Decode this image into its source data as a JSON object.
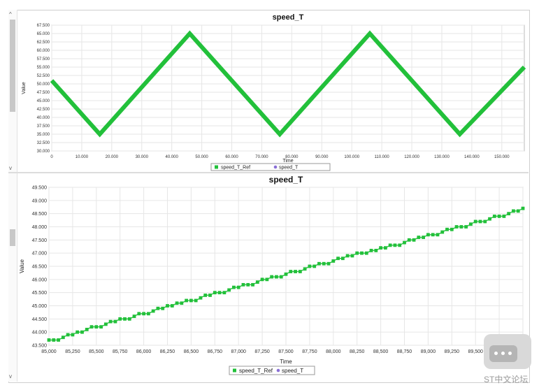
{
  "charts": [
    {
      "title": "speed_T",
      "xlabel": "Time",
      "ylabel": "Value",
      "yticks": [
        "30.000",
        "32.500",
        "35.000",
        "37.500",
        "40.000",
        "42.500",
        "45.000",
        "47.500",
        "50.000",
        "52.500",
        "55.000",
        "57.500",
        "60.000",
        "62.500",
        "65.000",
        "67.500"
      ],
      "xticks": [
        "0",
        "10.000",
        "20.000",
        "30.000",
        "40.000",
        "50.000",
        "60.000",
        "70.000",
        "80.000",
        "90.000",
        "100.000",
        "110.000",
        "120.000",
        "130.000",
        "140.000",
        "150.000"
      ],
      "legend": [
        "speed_T_Ref",
        "speed_T"
      ]
    },
    {
      "title": "speed_T",
      "xlabel": "Time",
      "ylabel": "Value",
      "yticks": [
        "43.500",
        "44.000",
        "44.500",
        "45.000",
        "45.500",
        "46.000",
        "46.500",
        "47.000",
        "47.500",
        "48.000",
        "48.500",
        "49.000",
        "49.500"
      ],
      "xticks": [
        "85,000",
        "85,250",
        "85,500",
        "85,750",
        "86,000",
        "86,250",
        "86,500",
        "86,750",
        "87,000",
        "87,250",
        "87,500",
        "87,750",
        "88,000",
        "88,250",
        "88,500",
        "88,750",
        "89,000",
        "89,250",
        "89,500",
        "89,750",
        "90,000"
      ],
      "legend": [
        "speed_T_Ref",
        "speed_T"
      ]
    }
  ],
  "colors": {
    "ref": "#22c03a",
    "speed": "#8a6fd6",
    "grid": "#e6e6e6"
  },
  "watermark": {
    "text": "ST中文论坛"
  },
  "chart_data": [
    {
      "type": "line",
      "title": "speed_T",
      "xlabel": "Time",
      "ylabel": "Value",
      "xlim": [
        0,
        157500
      ],
      "ylim": [
        30,
        67.5
      ],
      "grid": true,
      "legend_position": "bottom",
      "series": [
        {
          "name": "speed_T_Ref",
          "x": [
            0,
            16000,
            46000,
            76000,
            106000,
            136000,
            157500
          ],
          "y": [
            51,
            35,
            65,
            35,
            65,
            35,
            55
          ]
        }
      ]
    },
    {
      "type": "line",
      "title": "speed_T",
      "xlabel": "Time",
      "ylabel": "Value",
      "xlim": [
        85000,
        90000
      ],
      "ylim": [
        43.5,
        49.5
      ],
      "grid": true,
      "legend_position": "bottom",
      "series": [
        {
          "name": "speed_T_Ref",
          "x": [
            85000,
            85050,
            85100,
            85150,
            85200,
            85250,
            85300,
            85350,
            85400,
            85450,
            85500,
            85550,
            85600,
            85650,
            85700,
            85750,
            85800,
            85850,
            85900,
            85950,
            86000,
            86050,
            86100,
            86150,
            86200,
            86250,
            86300,
            86350,
            86400,
            86450,
            86500,
            86550,
            86600,
            86650,
            86700,
            86750,
            86800,
            86850,
            86900,
            86950,
            87000,
            87050,
            87100,
            87150,
            87200,
            87250,
            87300,
            87350,
            87400,
            87450,
            87500,
            87550,
            87600,
            87650,
            87700,
            87750,
            87800,
            87850,
            87900,
            87950,
            88000,
            88050,
            88100,
            88150,
            88200,
            88250,
            88300,
            88350,
            88400,
            88450,
            88500,
            88550,
            88600,
            88650,
            88700,
            88750,
            88800,
            88850,
            88900,
            88950,
            89000,
            89050,
            89100,
            89150,
            89200,
            89250,
            89300,
            89350,
            89400,
            89450,
            89500,
            89550,
            89600,
            89650,
            89700,
            89750,
            89800,
            89850,
            89900,
            89950,
            90000
          ],
          "y": [
            43.7,
            43.7,
            43.7,
            43.8,
            43.9,
            43.9,
            44.0,
            44.0,
            44.1,
            44.2,
            44.2,
            44.2,
            44.3,
            44.4,
            44.4,
            44.5,
            44.5,
            44.5,
            44.6,
            44.7,
            44.7,
            44.7,
            44.8,
            44.9,
            44.9,
            45.0,
            45.0,
            45.1,
            45.1,
            45.2,
            45.2,
            45.2,
            45.3,
            45.4,
            45.4,
            45.5,
            45.5,
            45.5,
            45.6,
            45.7,
            45.7,
            45.8,
            45.8,
            45.8,
            45.9,
            46.0,
            46.0,
            46.1,
            46.1,
            46.1,
            46.2,
            46.3,
            46.3,
            46.3,
            46.4,
            46.5,
            46.5,
            46.6,
            46.6,
            46.6,
            46.7,
            46.8,
            46.8,
            46.9,
            46.9,
            47.0,
            47.0,
            47.0,
            47.1,
            47.1,
            47.2,
            47.2,
            47.3,
            47.3,
            47.3,
            47.4,
            47.5,
            47.5,
            47.6,
            47.6,
            47.7,
            47.7,
            47.7,
            47.8,
            47.9,
            47.9,
            48.0,
            48.0,
            48.0,
            48.1,
            48.2,
            48.2,
            48.2,
            48.3,
            48.4,
            48.4,
            48.4,
            48.5,
            48.6,
            48.6,
            48.7
          ]
        }
      ]
    }
  ]
}
